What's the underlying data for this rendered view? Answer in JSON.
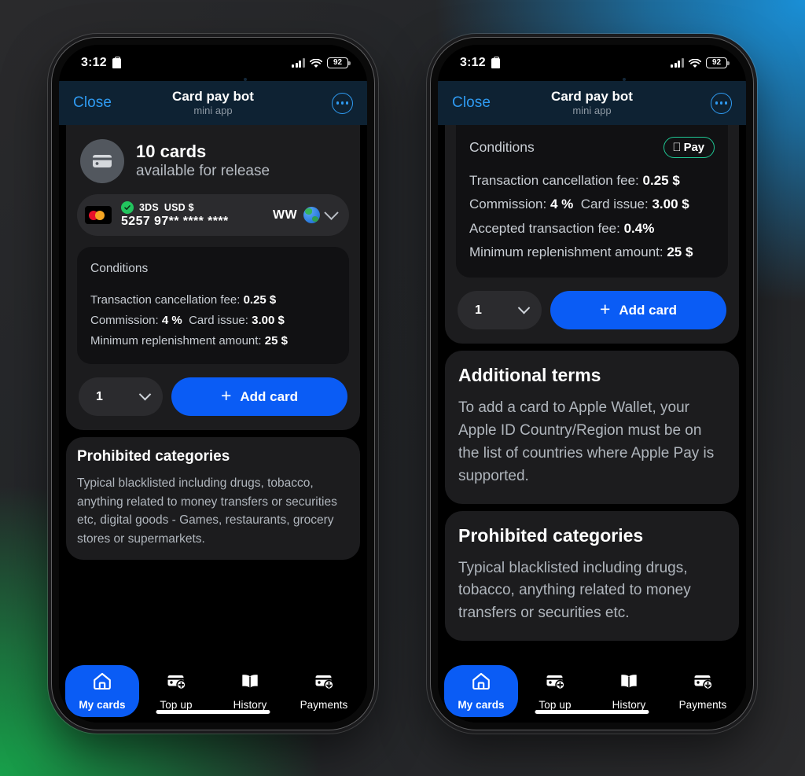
{
  "background": {
    "accent_blue": "#1a8fd6",
    "accent_green": "#17a04a",
    "base": "#2a2a2c"
  },
  "status_bar": {
    "time": "3:12",
    "battery": "92",
    "recording_icon": "recording-icon",
    "signal_icon": "cellular-signal-icon",
    "wifi_icon": "wifi-icon"
  },
  "app_header": {
    "close_label": "Close",
    "title": "Card pay bot",
    "subtitle": "mini app",
    "more_icon": "more-options-icon",
    "close_color": "#2f9bf2"
  },
  "left_phone": {
    "available": {
      "icon": "credit-card-icon",
      "count_text": "10 cards",
      "sub_text": "available for release"
    },
    "card_row": {
      "brand_icon": "mastercard-logo",
      "secure_badge_icon": "check-circle-icon",
      "secure_label": "3DS",
      "currency": "USD $",
      "number": "5257 97** **** ****",
      "region": "WW",
      "globe_icon": "globe-icon",
      "expand_icon": "chevron-down-icon"
    },
    "conditions": {
      "title": "Conditions",
      "apple_pay": null,
      "lines": [
        {
          "label": "Transaction cancellation fee:",
          "value": "0.25 $"
        },
        {
          "label": "Commission:",
          "value": "4 %",
          "label2": "Card issue:",
          "value2": "3.00 $"
        },
        {
          "label": "Minimum replenishment amount:",
          "value": "25 $"
        }
      ]
    },
    "actions": {
      "quantity": "1",
      "quantity_icon": "chevron-down-icon",
      "add_icon": "plus-icon",
      "add_label": "Add card",
      "add_color": "#0a5cf5"
    },
    "prohibited": {
      "title": "Prohibited categories",
      "body": "Typical blacklisted including drugs, tobacco, anything related to money transfers or securities etc, digital goods - Games, restaurants, grocery stores or supermarkets."
    }
  },
  "right_phone": {
    "conditions": {
      "title": "Conditions",
      "apple_pay": {
        "logo_icon": "apple-logo-icon",
        "label": "Pay",
        "border_color": "#1fc894"
      },
      "lines": [
        {
          "label": "Transaction cancellation fee:",
          "value": "0.25 $"
        },
        {
          "label": "Commission:",
          "value": "4 %",
          "label2": "Card issue:",
          "value2": "3.00 $"
        },
        {
          "label": "Accepted transaction fee:",
          "value": "0.4%"
        },
        {
          "label": "Minimum replenishment amount:",
          "value": "25 $"
        }
      ]
    },
    "actions": {
      "quantity": "1",
      "quantity_icon": "chevron-down-icon",
      "add_icon": "plus-icon",
      "add_label": "Add card",
      "add_color": "#0a5cf5"
    },
    "additional_terms": {
      "title": "Additional terms",
      "body": "To add a card to Apple Wallet, your Apple ID Country/Region must be on the list of countries where Apple Pay is supported."
    },
    "prohibited": {
      "title": "Prohibited categories",
      "body": "Typical blacklisted including drugs, tobacco, anything related to money transfers or securities etc."
    }
  },
  "tabbar": {
    "items": [
      {
        "label": "My cards",
        "icon": "home-icon",
        "active": true
      },
      {
        "label": "Top up",
        "icon": "card-plus-icon",
        "active": false
      },
      {
        "label": "History",
        "icon": "book-icon",
        "active": false
      },
      {
        "label": "Payments",
        "icon": "card-download-icon",
        "active": false
      }
    ],
    "active_color": "#0a5cf5"
  }
}
